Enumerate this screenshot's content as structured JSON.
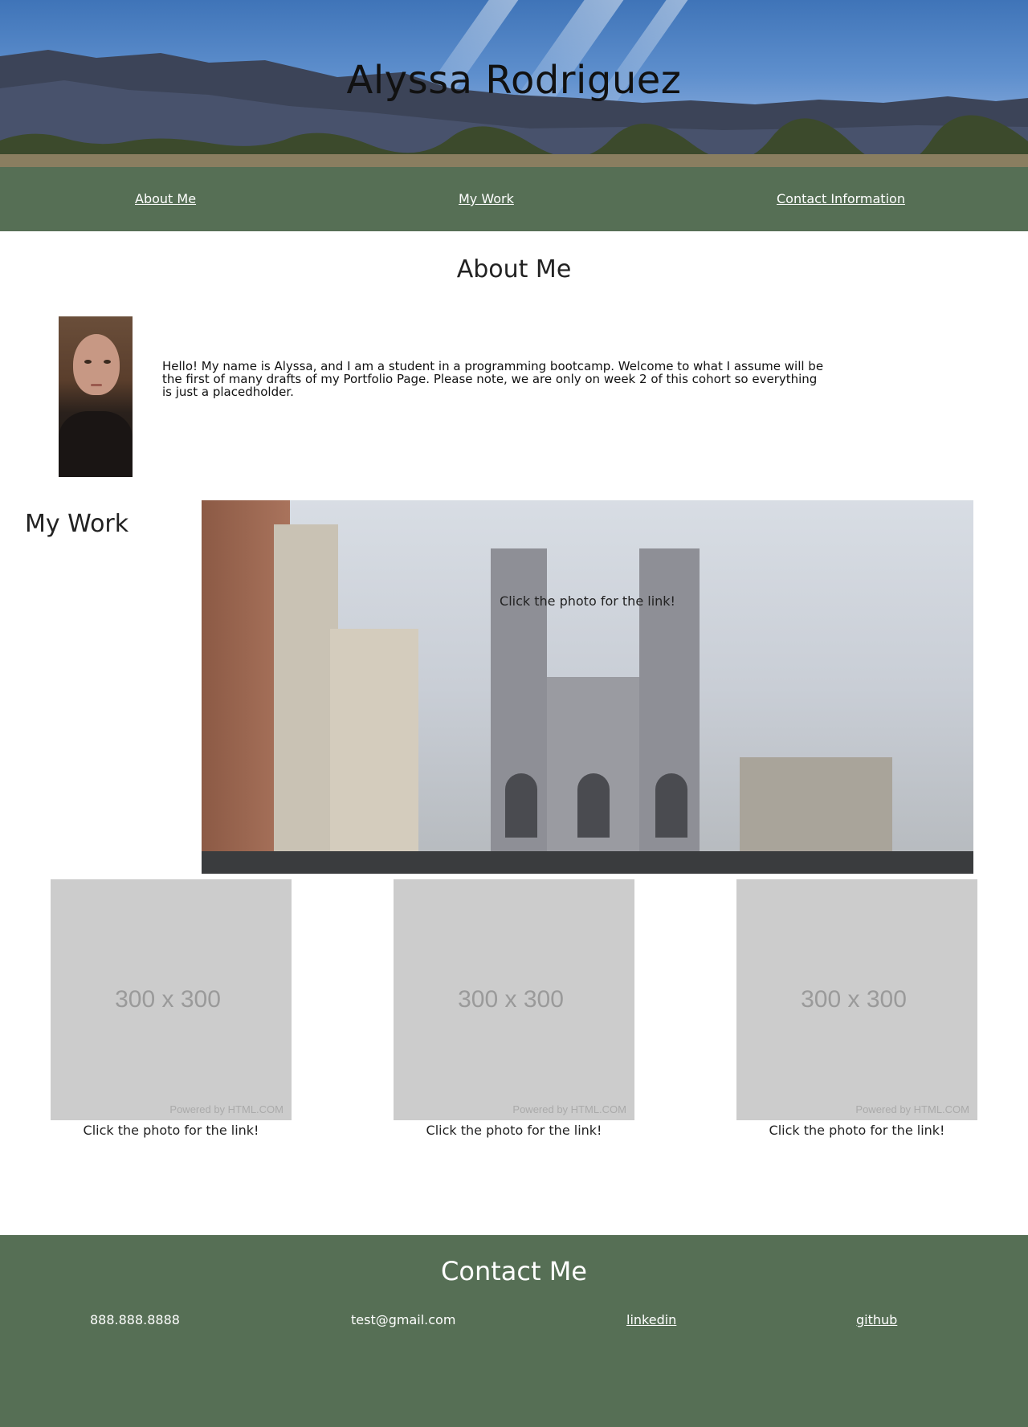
{
  "header": {
    "name": "Alyssa Rodriguez"
  },
  "nav": {
    "items": [
      {
        "label": "About Me"
      },
      {
        "label": "My Work"
      },
      {
        "label": "Contact Information"
      }
    ]
  },
  "about": {
    "title": "About Me",
    "text": "Hello! My name is Alyssa, and I am a student in a programming bootcamp. Welcome to what I assume will be the first of many drafts of my Portfolio Page. Please note, we are only on week 2 of this cohort so everything is just a placedholder."
  },
  "work": {
    "title": "My Work",
    "featured_caption": "Click the photo for the link!",
    "placeholders": [
      {
        "size_text": "300 x 300",
        "powered": "Powered by HTML.COM",
        "caption": "Click the photo for the link!"
      },
      {
        "size_text": "300 x 300",
        "powered": "Powered by HTML.COM",
        "caption": "Click the photo for the link!"
      },
      {
        "size_text": "300 x 300",
        "powered": "Powered by HTML.COM",
        "caption": "Click the photo for the link!"
      }
    ]
  },
  "contact": {
    "title": "Contact Me",
    "phone": "888.888.8888",
    "email": "test@gmail.com",
    "linkedin": "linkedin",
    "github": "github"
  },
  "colors": {
    "nav_bg": "#566f55",
    "footer_bg": "#566f55",
    "placeholder_bg": "#cccccc"
  }
}
